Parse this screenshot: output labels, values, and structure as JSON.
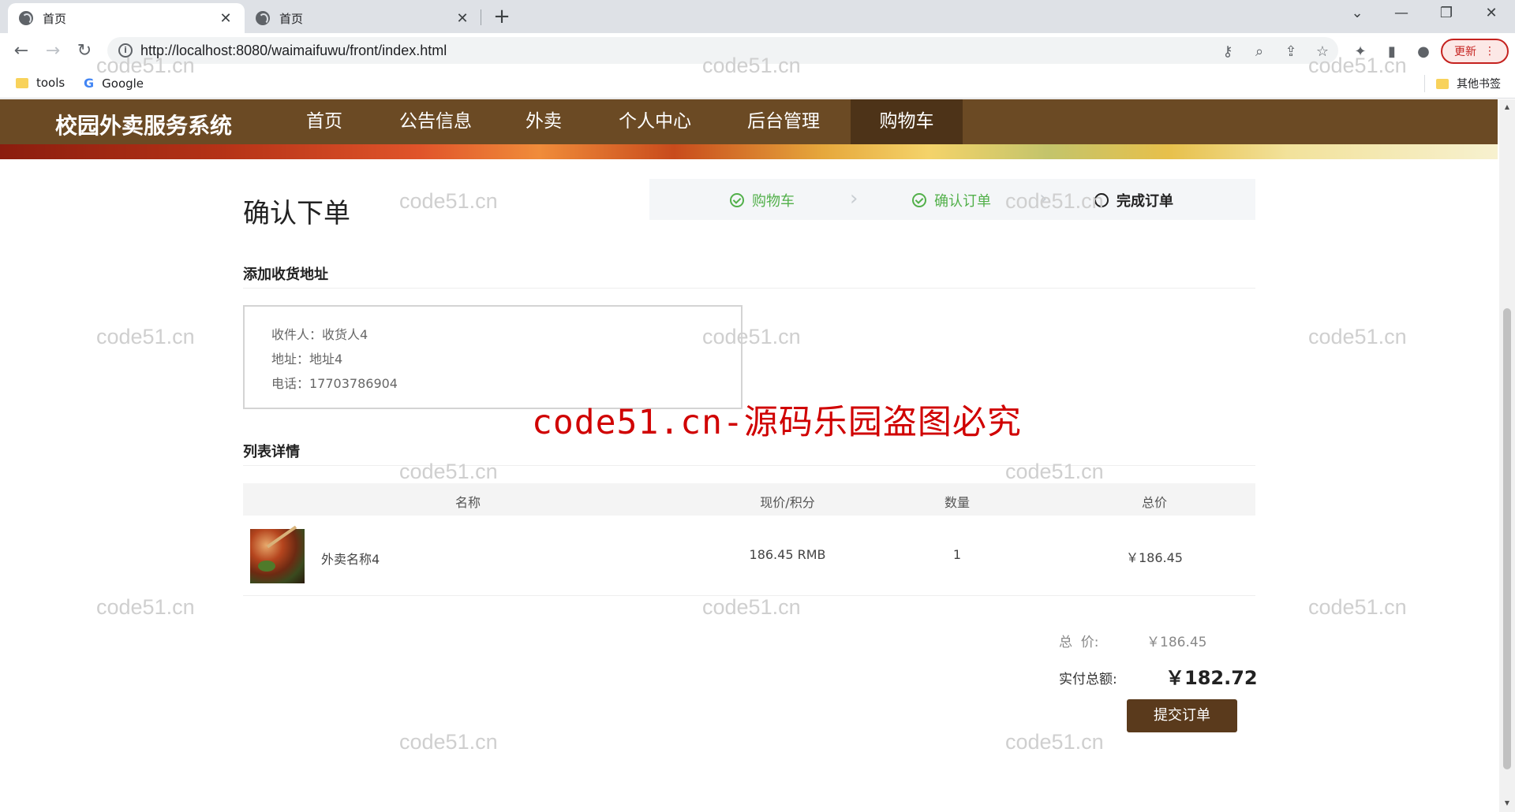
{
  "browser": {
    "tabs": [
      {
        "title": "首页",
        "close": "✕"
      },
      {
        "title": "首页",
        "close": "✕"
      }
    ],
    "new_tab": "+",
    "window_controls": {
      "dropdown": "⌄",
      "minimize": "—",
      "restore": "❐",
      "close": "✕"
    },
    "url": "http://localhost:8080/waimaifuwu/front/index.html",
    "update_label": "更新",
    "bookmarks": [
      {
        "label": "tools",
        "icon": "folder-icon"
      },
      {
        "label": "Google",
        "icon": "google-icon"
      }
    ],
    "other_bookmarks": "其他书签"
  },
  "site": {
    "title": "校园外卖服务系统",
    "nav": [
      "首页",
      "公告信息",
      "外卖",
      "个人中心",
      "后台管理",
      "购物车"
    ],
    "active_nav": "购物车"
  },
  "checkout": {
    "heading": "确认下单",
    "steps": [
      {
        "label": "购物车",
        "state": "done"
      },
      {
        "label": "确认订单",
        "state": "done"
      },
      {
        "label": "完成订单",
        "state": "current"
      }
    ],
    "address_section_title": "添加收货地址",
    "address": {
      "recipient": "收件人：收货人4",
      "address": "地址：地址4",
      "phone": "电话：17703786904"
    },
    "list_section_title": "列表详情",
    "table": {
      "headers": [
        "名称",
        "现价/积分",
        "数量",
        "总价"
      ],
      "rows": [
        {
          "name": "外卖名称4",
          "price": "186.45 RMB",
          "quantity": "1",
          "total": "￥186.45"
        }
      ]
    },
    "summary": {
      "total_label": "总  价:",
      "total_value": "￥186.45",
      "pay_label": "实付总额:",
      "pay_value": "￥182.72"
    },
    "submit_label": "提交订单"
  },
  "watermarks": {
    "small": "code51.cn",
    "main": "code51.cn-源码乐园盗图必究"
  },
  "colors": {
    "nav_bg": "#6b4a24",
    "nav_active": "#4d3318",
    "step_done": "#52b04a",
    "submit_bg": "#5a3a1c",
    "watermark_main": "#d00000"
  }
}
